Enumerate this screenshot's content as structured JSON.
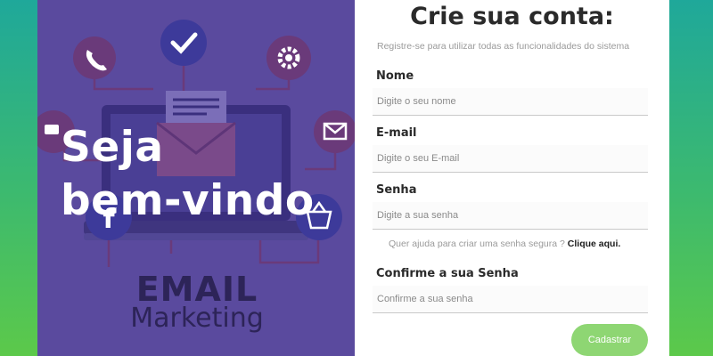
{
  "welcome": {
    "line1": "Seja",
    "line2": "bem-vindo"
  },
  "logo": {
    "top": "EMAIL",
    "bottom": "Marketing"
  },
  "illustration_icons": [
    "phone-icon",
    "check-icon",
    "gear-icon",
    "email-icon",
    "chat-icon",
    "basket-icon",
    "facebook-icon",
    "laptop-icon",
    "envelope-icon"
  ],
  "form": {
    "title": "Crie sua conta:",
    "subtitle": "Registre-se para utilizar todas as funcionalidades do sistema",
    "name": {
      "label": "Nome",
      "placeholder": "Digite o seu nome"
    },
    "email": {
      "label": "E-mail",
      "placeholder": "Digite o seu E-mail"
    },
    "password": {
      "label": "Senha",
      "placeholder": "Digite a sua senha"
    },
    "help_text": "Quer ajuda para criar uma senha segura ?",
    "help_link": "Clique aqui.",
    "confirm": {
      "label": "Confirme a sua Senha",
      "placeholder": "Confirme a sua senha"
    },
    "submit_label": "Cadastrar"
  },
  "colors": {
    "panel_purple": "#5a4a9e",
    "button_green": "#8ed673",
    "bg_teal": "#1fa89a",
    "bg_green": "#5cc94a"
  }
}
